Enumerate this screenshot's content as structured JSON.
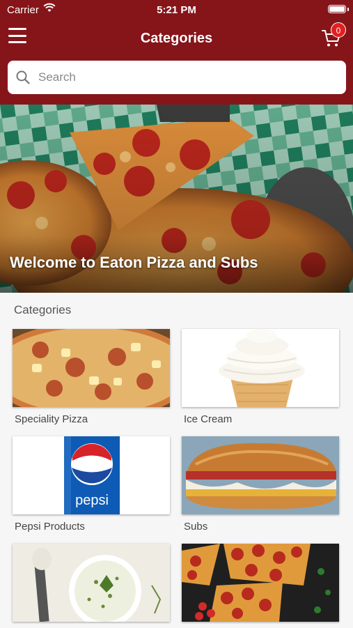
{
  "status_bar": {
    "carrier": "Carrier",
    "time": "5:21 PM"
  },
  "nav": {
    "title": "Categories",
    "cart_count": "0"
  },
  "search": {
    "placeholder": "Search"
  },
  "hero": {
    "welcome_text": "Welcome to Eaton Pizza and Subs"
  },
  "section": {
    "title": "Categories"
  },
  "categories": [
    {
      "label": "Speciality Pizza"
    },
    {
      "label": "Ice Cream"
    },
    {
      "label": "Pepsi Products",
      "brand_text": "pepsi"
    },
    {
      "label": "Subs"
    },
    {
      "label": ""
    },
    {
      "label": ""
    }
  ],
  "colors": {
    "header": "#86151a",
    "badge": "#e02020"
  }
}
